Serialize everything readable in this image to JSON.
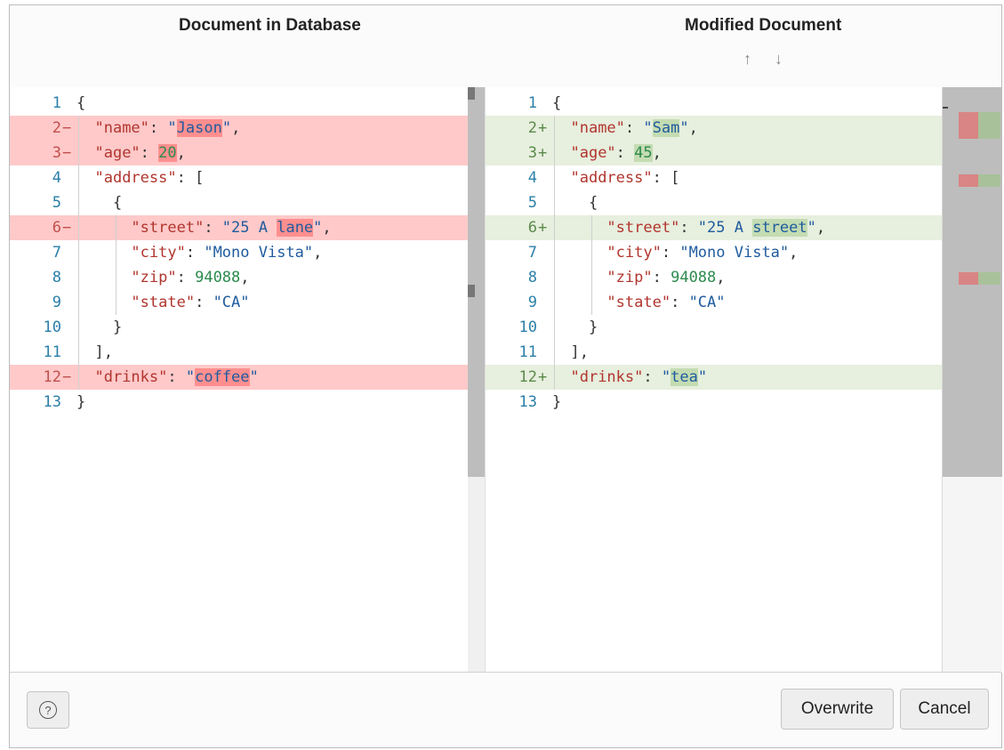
{
  "left_title": "Document in Database",
  "right_title": "Modified Document",
  "nav": {
    "up": "↑",
    "down": "↓"
  },
  "left_lines": [
    {
      "n": "1",
      "m": "",
      "type": "",
      "parts": [
        {
          "t": "{",
          "c": "p"
        }
      ]
    },
    {
      "n": "2",
      "m": "−",
      "type": "del",
      "parts": [
        {
          "t": "  "
        },
        {
          "t": "\"name\"",
          "c": "k"
        },
        {
          "t": ": ",
          "c": "p"
        },
        {
          "t": "\"",
          "c": "s"
        },
        {
          "t": "Jason",
          "c": "s",
          "hl": 1
        },
        {
          "t": "\"",
          "c": "s"
        },
        {
          "t": ",",
          "c": "p"
        }
      ]
    },
    {
      "n": "3",
      "m": "−",
      "type": "del",
      "parts": [
        {
          "t": "  "
        },
        {
          "t": "\"age\"",
          "c": "k"
        },
        {
          "t": ": ",
          "c": "p"
        },
        {
          "t": "20",
          "c": "n",
          "hl": 1
        },
        {
          "t": ",",
          "c": "p"
        }
      ]
    },
    {
      "n": "4",
      "m": "",
      "type": "",
      "parts": [
        {
          "t": "  "
        },
        {
          "t": "\"address\"",
          "c": "k"
        },
        {
          "t": ": [",
          "c": "p"
        }
      ]
    },
    {
      "n": "5",
      "m": "",
      "type": "",
      "parts": [
        {
          "t": "    "
        },
        {
          "t": "{",
          "c": "p"
        }
      ]
    },
    {
      "n": "6",
      "m": "−",
      "type": "del",
      "parts": [
        {
          "t": "      "
        },
        {
          "t": "\"street\"",
          "c": "k"
        },
        {
          "t": ": ",
          "c": "p"
        },
        {
          "t": "\"25 A ",
          "c": "s"
        },
        {
          "t": "lane",
          "c": "s",
          "hl": 1
        },
        {
          "t": "\"",
          "c": "s"
        },
        {
          "t": ",",
          "c": "p"
        }
      ]
    },
    {
      "n": "7",
      "m": "",
      "type": "",
      "parts": [
        {
          "t": "      "
        },
        {
          "t": "\"city\"",
          "c": "k"
        },
        {
          "t": ": ",
          "c": "p"
        },
        {
          "t": "\"Mono Vista\"",
          "c": "s"
        },
        {
          "t": ",",
          "c": "p"
        }
      ]
    },
    {
      "n": "8",
      "m": "",
      "type": "",
      "parts": [
        {
          "t": "      "
        },
        {
          "t": "\"zip\"",
          "c": "k"
        },
        {
          "t": ": ",
          "c": "p"
        },
        {
          "t": "94088",
          "c": "n"
        },
        {
          "t": ",",
          "c": "p"
        }
      ]
    },
    {
      "n": "9",
      "m": "",
      "type": "",
      "parts": [
        {
          "t": "      "
        },
        {
          "t": "\"state\"",
          "c": "k"
        },
        {
          "t": ": ",
          "c": "p"
        },
        {
          "t": "\"CA\"",
          "c": "s"
        }
      ]
    },
    {
      "n": "10",
      "m": "",
      "type": "",
      "parts": [
        {
          "t": "    "
        },
        {
          "t": "}",
          "c": "p"
        }
      ]
    },
    {
      "n": "11",
      "m": "",
      "type": "",
      "parts": [
        {
          "t": "  "
        },
        {
          "t": "],",
          "c": "p"
        }
      ]
    },
    {
      "n": "12",
      "m": "−",
      "type": "del",
      "parts": [
        {
          "t": "  "
        },
        {
          "t": "\"drinks\"",
          "c": "k"
        },
        {
          "t": ": ",
          "c": "p"
        },
        {
          "t": "\"",
          "c": "s"
        },
        {
          "t": "coffee",
          "c": "s",
          "hl": 1
        },
        {
          "t": "\"",
          "c": "s"
        }
      ]
    },
    {
      "n": "13",
      "m": "",
      "type": "",
      "parts": [
        {
          "t": "}",
          "c": "p"
        }
      ]
    }
  ],
  "right_lines": [
    {
      "n": "1",
      "m": "",
      "type": "",
      "parts": [
        {
          "t": "{",
          "c": "p"
        }
      ]
    },
    {
      "n": "2",
      "m": "+",
      "type": "ins",
      "parts": [
        {
          "t": "  "
        },
        {
          "t": "\"name\"",
          "c": "k"
        },
        {
          "t": ": ",
          "c": "p"
        },
        {
          "t": "\"",
          "c": "s"
        },
        {
          "t": "Sam",
          "c": "s",
          "hl": 1
        },
        {
          "t": "\"",
          "c": "s"
        },
        {
          "t": ",",
          "c": "p"
        }
      ]
    },
    {
      "n": "3",
      "m": "+",
      "type": "ins",
      "parts": [
        {
          "t": "  "
        },
        {
          "t": "\"age\"",
          "c": "k"
        },
        {
          "t": ": ",
          "c": "p"
        },
        {
          "t": "45",
          "c": "n",
          "hl": 1
        },
        {
          "t": ",",
          "c": "p"
        }
      ]
    },
    {
      "n": "4",
      "m": "",
      "type": "",
      "parts": [
        {
          "t": "  "
        },
        {
          "t": "\"address\"",
          "c": "k"
        },
        {
          "t": ": [",
          "c": "p"
        }
      ]
    },
    {
      "n": "5",
      "m": "",
      "type": "",
      "parts": [
        {
          "t": "    "
        },
        {
          "t": "{",
          "c": "p"
        }
      ]
    },
    {
      "n": "6",
      "m": "+",
      "type": "ins",
      "parts": [
        {
          "t": "      "
        },
        {
          "t": "\"street\"",
          "c": "k"
        },
        {
          "t": ": ",
          "c": "p"
        },
        {
          "t": "\"25 A ",
          "c": "s"
        },
        {
          "t": "street",
          "c": "s",
          "hl": 1
        },
        {
          "t": "\"",
          "c": "s"
        },
        {
          "t": ",",
          "c": "p"
        }
      ]
    },
    {
      "n": "7",
      "m": "",
      "type": "",
      "parts": [
        {
          "t": "      "
        },
        {
          "t": "\"city\"",
          "c": "k"
        },
        {
          "t": ": ",
          "c": "p"
        },
        {
          "t": "\"Mono Vista\"",
          "c": "s"
        },
        {
          "t": ",",
          "c": "p"
        }
      ]
    },
    {
      "n": "8",
      "m": "",
      "type": "",
      "parts": [
        {
          "t": "      "
        },
        {
          "t": "\"zip\"",
          "c": "k"
        },
        {
          "t": ": ",
          "c": "p"
        },
        {
          "t": "94088",
          "c": "n"
        },
        {
          "t": ",",
          "c": "p"
        }
      ]
    },
    {
      "n": "9",
      "m": "",
      "type": "",
      "parts": [
        {
          "t": "      "
        },
        {
          "t": "\"state\"",
          "c": "k"
        },
        {
          "t": ": ",
          "c": "p"
        },
        {
          "t": "\"CA\"",
          "c": "s"
        }
      ]
    },
    {
      "n": "10",
      "m": "",
      "type": "",
      "parts": [
        {
          "t": "    "
        },
        {
          "t": "}",
          "c": "p"
        }
      ]
    },
    {
      "n": "11",
      "m": "",
      "type": "",
      "parts": [
        {
          "t": "  "
        },
        {
          "t": "],",
          "c": "p"
        }
      ]
    },
    {
      "n": "12",
      "m": "+",
      "type": "ins",
      "parts": [
        {
          "t": "  "
        },
        {
          "t": "\"drinks\"",
          "c": "k"
        },
        {
          "t": ": ",
          "c": "p"
        },
        {
          "t": "\"",
          "c": "s"
        },
        {
          "t": "tea",
          "c": "s",
          "hl": 1
        },
        {
          "t": "\"",
          "c": "s"
        }
      ]
    },
    {
      "n": "13",
      "m": "",
      "type": "",
      "parts": [
        {
          "t": "}",
          "c": "p"
        }
      ]
    }
  ],
  "footer": {
    "help_icon": "?",
    "overwrite_label": "Overwrite",
    "cancel_label": "Cancel"
  },
  "colors": {
    "deleted_line": "#ffc9c9",
    "deleted_highlight": "#ff8f8f",
    "inserted_line": "#e7efde",
    "inserted_highlight": "#c4dcb2",
    "key": "#b1352e",
    "string": "#1f5b9e",
    "number": "#2d8a4e",
    "line_number": "#2b7fa8"
  }
}
